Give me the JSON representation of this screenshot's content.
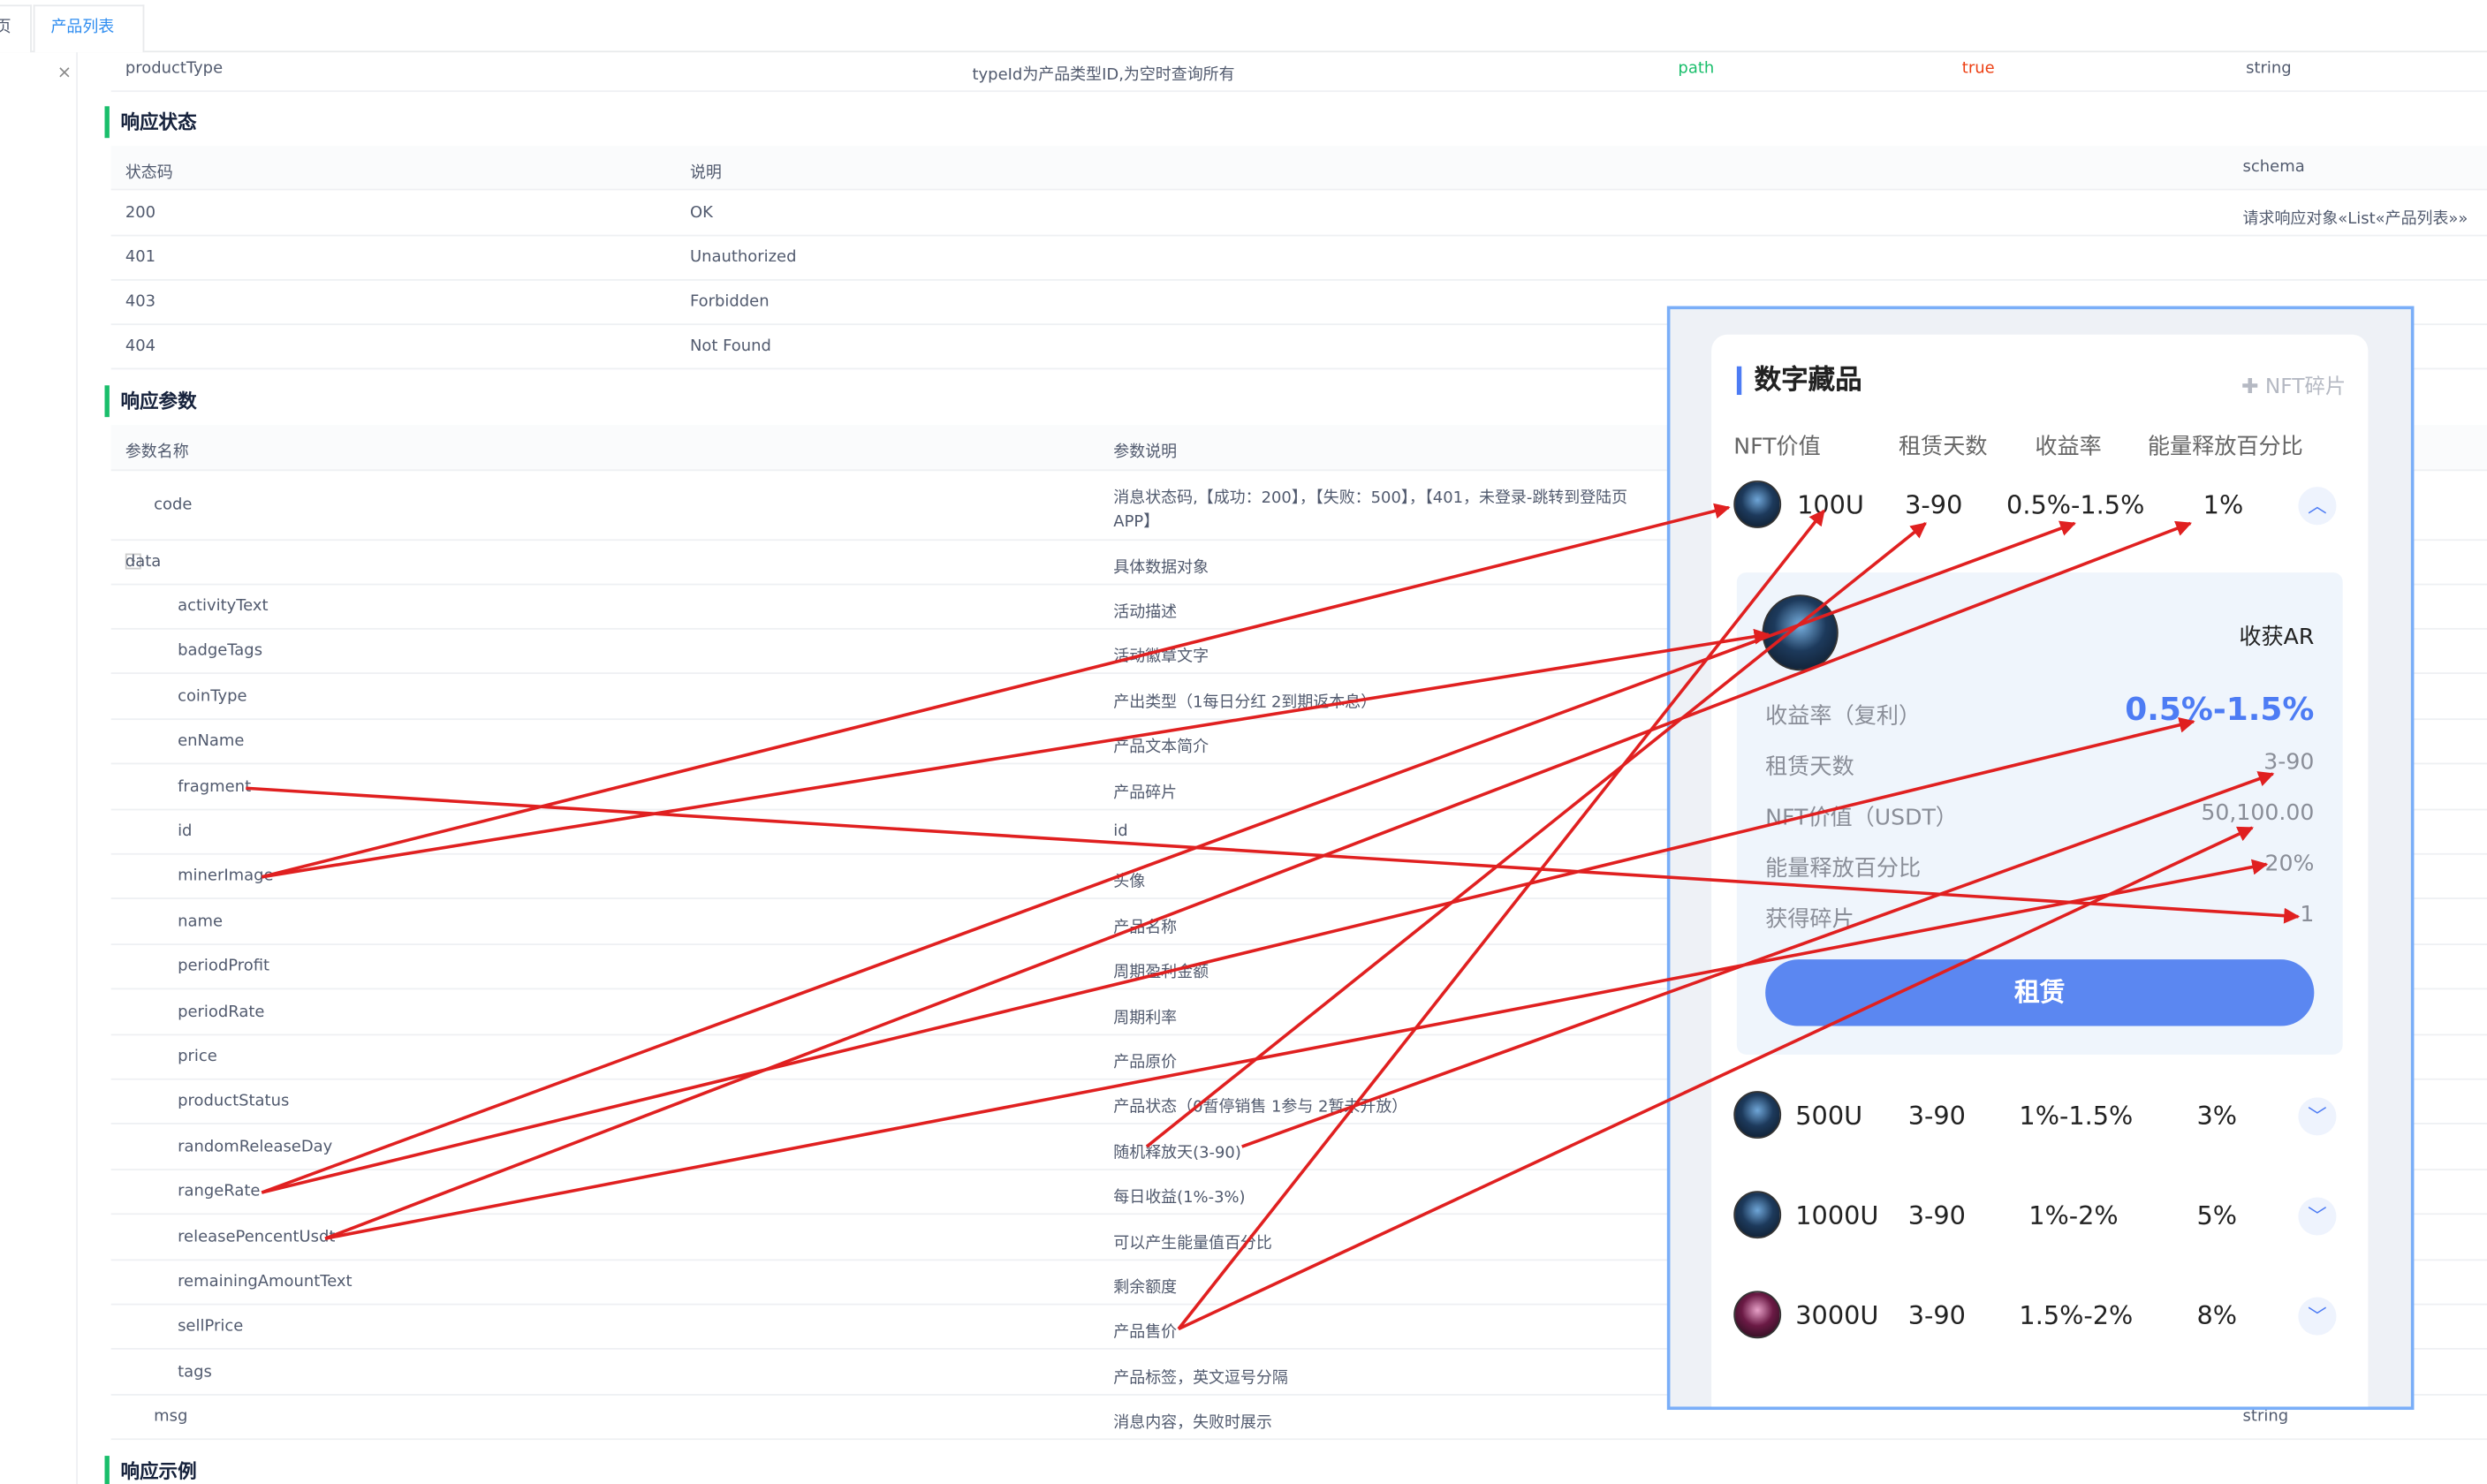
{
  "tabs": [
    {
      "label": "页"
    },
    {
      "label": "产品列表",
      "close": "×"
    }
  ],
  "param_row": {
    "name": "productType",
    "desc": "typeId为产品类型ID,为空时查询所有",
    "in": "path",
    "required": "true",
    "type": "string"
  },
  "sections": {
    "status": "响应状态",
    "params": "响应参数",
    "example": "响应示例"
  },
  "status_table": {
    "headers": [
      "状态码",
      "说明",
      "schema"
    ],
    "rows": [
      {
        "code": "200",
        "desc": "OK",
        "schema": "请求响应对象«List«产品列表»»"
      },
      {
        "code": "401",
        "desc": "Unauthorized",
        "schema": ""
      },
      {
        "code": "403",
        "desc": "Forbidden",
        "schema": ""
      },
      {
        "code": "404",
        "desc": "Not Found",
        "schema": ""
      }
    ]
  },
  "params_table": {
    "headers": [
      "参数名称",
      "参数说明"
    ],
    "rows": [
      {
        "name": "code",
        "desc": "消息状态码,【成功：200】，【失败：500】，【401，未登录-跳转到登陆页",
        "desc2": "APP】"
      },
      {
        "name": "data",
        "desc": "具体数据对象",
        "toggle": "-"
      },
      {
        "name": "activityText",
        "desc": "活动描述"
      },
      {
        "name": "badgeTags",
        "desc": "活动徽章文字"
      },
      {
        "name": "coinType",
        "desc": "产出类型（1每日分红 2到期返本息）"
      },
      {
        "name": "enName",
        "desc": "产品文本简介"
      },
      {
        "name": "fragment",
        "desc": "产品碎片"
      },
      {
        "name": "id",
        "desc": "id"
      },
      {
        "name": "minerImage",
        "desc": "头像"
      },
      {
        "name": "name",
        "desc": "产品名称"
      },
      {
        "name": "periodProfit",
        "desc": "周期盈利金额"
      },
      {
        "name": "periodRate",
        "desc": "周期利率"
      },
      {
        "name": "price",
        "desc": "产品原价"
      },
      {
        "name": "productStatus",
        "desc": "产品状态（0暂停销售 1参与 2暂未开放）"
      },
      {
        "name": "randomReleaseDay",
        "desc": "随机释放天(3-90)"
      },
      {
        "name": "rangeRate",
        "desc": "每日收益(1%-3%)"
      },
      {
        "name": "releasePencentUsdt",
        "desc": "可以产生能量值百分比"
      },
      {
        "name": "remainingAmountText",
        "desc": "剩余额度"
      },
      {
        "name": "sellPrice",
        "desc": "产品售价"
      },
      {
        "name": "tags",
        "desc": "产品标签，英文逗号分隔"
      },
      {
        "name": "msg",
        "desc": "消息内容，失败时展示",
        "type": "string"
      }
    ]
  },
  "card": {
    "title": "数字藏品",
    "fragment_link": "NFT碎片",
    "columns": [
      "NFT价值",
      "租赁天数",
      "收益率",
      "能量释放百分比"
    ],
    "products": [
      {
        "value": "100U",
        "days": "3-90",
        "rate": "0.5%-1.5%",
        "release": "1%",
        "expanded": true
      },
      {
        "value": "500U",
        "days": "3-90",
        "rate": "1%-1.5%",
        "release": "3%"
      },
      {
        "value": "1000U",
        "days": "3-90",
        "rate": "1%-2%",
        "release": "5%"
      },
      {
        "value": "3000U",
        "days": "3-90",
        "rate": "1.5%-2%",
        "release": "8%"
      }
    ],
    "detail": {
      "harvest": "收获AR",
      "rows": [
        {
          "label": "收益率（复利）",
          "value": "0.5%-1.5%"
        },
        {
          "label": "租赁天数",
          "value": "3-90"
        },
        {
          "label": "NFT价值（USDT）",
          "value": "50,100.00"
        },
        {
          "label": "能量释放百分比",
          "value": "20%"
        },
        {
          "label": "获得碎片",
          "value": "1"
        }
      ],
      "button": "租赁"
    }
  },
  "colors": {
    "accent": "#4d7cf4",
    "section_bar": "#19be6b",
    "arrow": "#e02020",
    "tab_active": "#2d8cf0"
  }
}
